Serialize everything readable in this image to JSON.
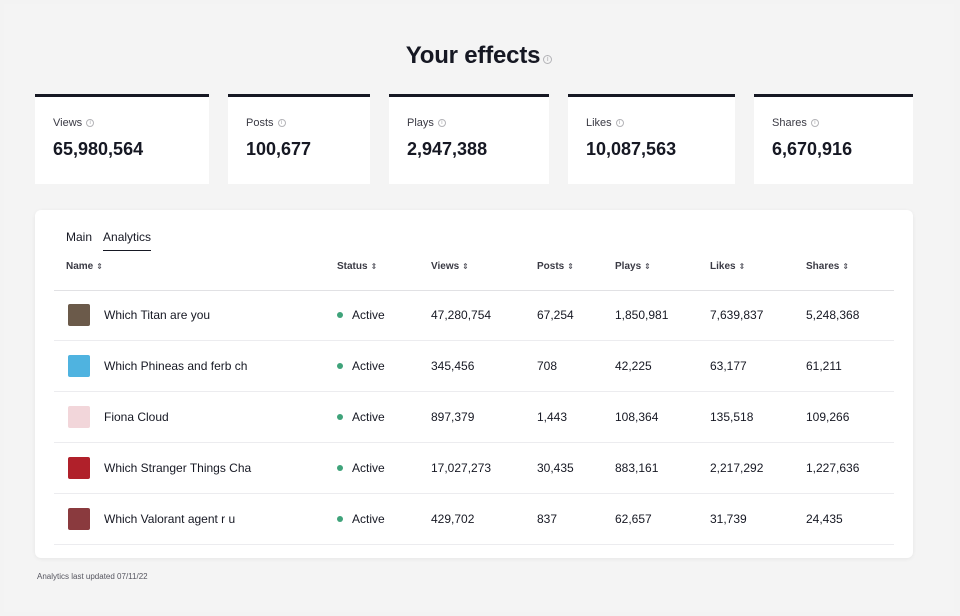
{
  "header": {
    "title": "Your effects",
    "info_icon": "info-icon"
  },
  "stats": [
    {
      "label": "Views",
      "value": "65,980,564"
    },
    {
      "label": "Posts",
      "value": "100,677"
    },
    {
      "label": "Plays",
      "value": "2,947,388"
    },
    {
      "label": "Likes",
      "value": "10,087,563"
    },
    {
      "label": "Shares",
      "value": "6,670,916"
    }
  ],
  "tabs": [
    {
      "label": "Main",
      "active": false
    },
    {
      "label": "Analytics",
      "active": true
    }
  ],
  "table": {
    "columns": [
      "Name",
      "Status",
      "Views",
      "Posts",
      "Plays",
      "Likes",
      "Shares"
    ],
    "sort_icon": "sort-icon",
    "rows": [
      {
        "thumb_color": "#6b5a4a",
        "name": "Which Titan are you",
        "status": "Active",
        "views": "47,280,754",
        "posts": "67,254",
        "plays": "1,850,981",
        "likes": "7,639,837",
        "shares": "5,248,368"
      },
      {
        "thumb_color": "#4fb3e0",
        "name": "Which Phineas and ferb ch",
        "status": "Active",
        "views": "345,456",
        "posts": "708",
        "plays": "42,225",
        "likes": "63,177",
        "shares": "61,211"
      },
      {
        "thumb_color": "#f2d6da",
        "name": "Fiona Cloud",
        "status": "Active",
        "views": "897,379",
        "posts": "1,443",
        "plays": "108,364",
        "likes": "135,518",
        "shares": "109,266"
      },
      {
        "thumb_color": "#b0202a",
        "name": "Which Stranger Things Cha",
        "status": "Active",
        "views": "17,027,273",
        "posts": "30,435",
        "plays": "883,161",
        "likes": "2,217,292",
        "shares": "1,227,636"
      },
      {
        "thumb_color": "#8a3a3e",
        "name": "Which Valorant agent r u",
        "status": "Active",
        "views": "429,702",
        "posts": "837",
        "plays": "62,657",
        "likes": "31,739",
        "shares": "24,435"
      }
    ]
  },
  "footer": {
    "note": "Analytics last updated 07/11/22"
  },
  "colors": {
    "status_active": "#3fa37a",
    "accent_border": "#161823"
  }
}
